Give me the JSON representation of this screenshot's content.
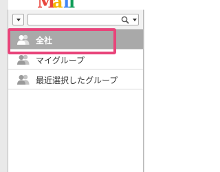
{
  "background": {
    "logo_fragment": [
      {
        "text": "M",
        "color": "#e8453c"
      },
      {
        "text": "a",
        "color": "#f4b400"
      },
      {
        "text": "i",
        "color": "#4285f4"
      },
      {
        "text": "l",
        "color": "#0f9d58"
      }
    ]
  },
  "toolbar": {
    "dropdown_icon": "chevron-down-icon",
    "search": {
      "value": "",
      "placeholder": "",
      "icon": "search-icon",
      "options_icon": "chevron-down-icon"
    }
  },
  "groups": {
    "items": [
      {
        "label": "全社",
        "icon": "user-group-icon",
        "selected": true
      },
      {
        "label": "マイグループ",
        "icon": "user-group-icon",
        "selected": false
      },
      {
        "label": "最近選択したグループ",
        "icon": "user-group-icon",
        "selected": false
      }
    ]
  },
  "colors": {
    "selected_row": "#a9a9a9",
    "highlight": "#e8447a",
    "icon_gray": "#9a9a9a"
  }
}
